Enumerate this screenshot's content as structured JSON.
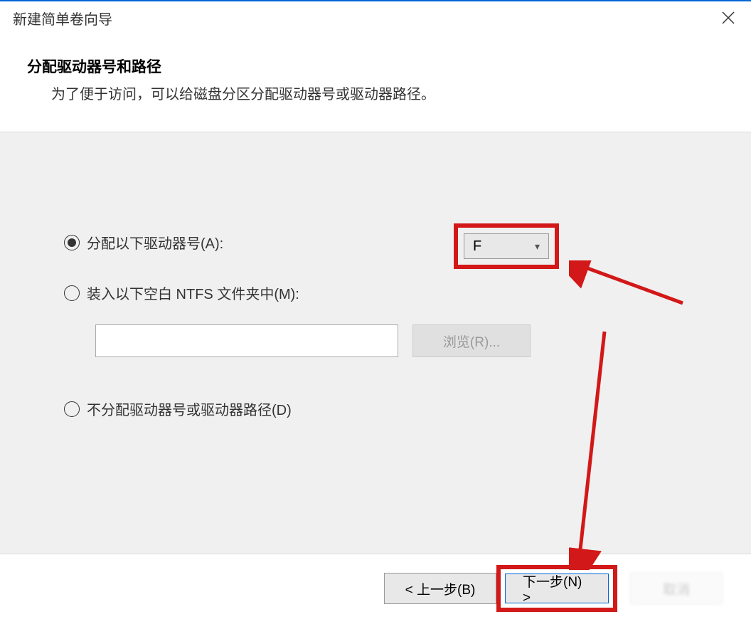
{
  "window": {
    "title": "新建简单卷向导"
  },
  "header": {
    "title": "分配驱动器号和路径",
    "subtitle": "为了便于访问，可以给磁盘分区分配驱动器号或驱动器路径。"
  },
  "options": {
    "assign_letter_label": "分配以下驱动器号(A):",
    "mount_folder_label": "装入以下空白 NTFS 文件夹中(M):",
    "no_assign_label": "不分配驱动器号或驱动器路径(D)",
    "selected_drive": "F",
    "browse_label": "浏览(R)..."
  },
  "footer": {
    "back": "< 上一步(B)",
    "next": "下一步(N) >",
    "cancel": "取消"
  }
}
